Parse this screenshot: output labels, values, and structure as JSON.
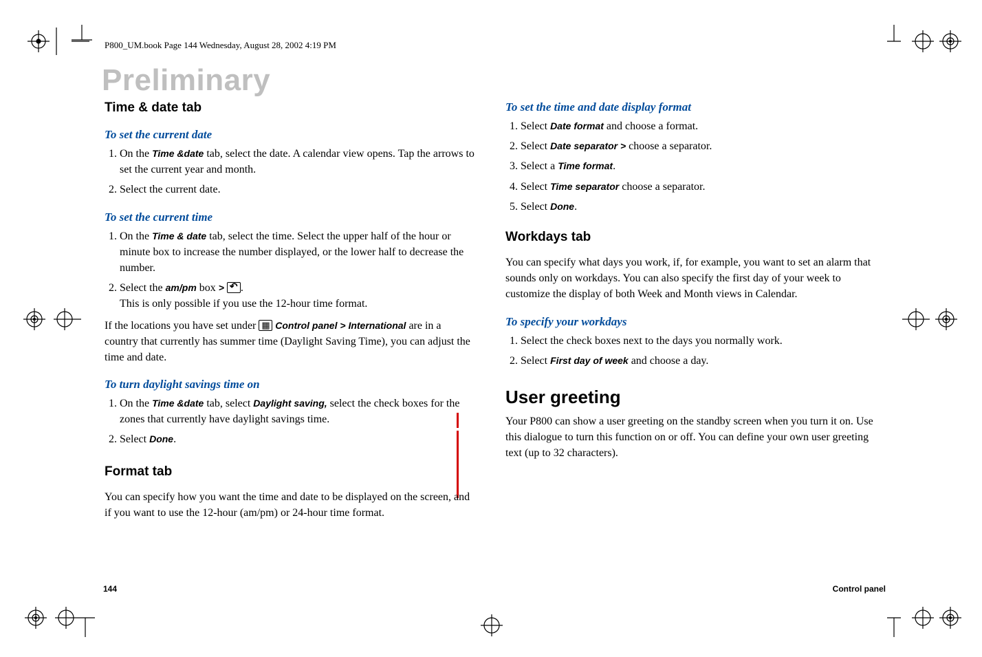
{
  "running_head": "P800_UM.book  Page 144  Wednesday, August 28, 2002  4:19 PM",
  "watermark": "Preliminary",
  "footer": {
    "page_num": "144",
    "section": "Control panel"
  },
  "left": {
    "time_date_tab": {
      "heading": "Time & date tab",
      "set_current_date": {
        "title": "To set the current date",
        "step1_a": "On the ",
        "step1_label": "Time &date",
        "step1_b": " tab, select the date. A calendar view opens. Tap the arrows to set the current year and month.",
        "step2": "Select the current date."
      },
      "set_current_time": {
        "title": "To set the current time",
        "step1_a": "On the ",
        "step1_label": "Time & date",
        "step1_b": " tab, select the time. Select the upper half of the hour or minute box to increase the number displayed, or the lower half to decrease the number.",
        "step2_a": "Select the ",
        "step2_label": "am/pm",
        "step2_b": " box ",
        "step2_gt": "> ",
        "step2_c": ".",
        "step2_note": "This is only possible if you use the 12-hour time format.",
        "para_a": "If the locations you have set under ",
        "para_label1": " Control panel > International",
        "para_b": " are in a country that currently has summer time (Daylight Saving Time), you can adjust the time and date."
      },
      "dst": {
        "title": "To turn daylight savings time on",
        "step1_a": "On the ",
        "step1_label1": "Time &date",
        "step1_b": " tab, select ",
        "step1_label2": "Daylight saving,",
        "step1_c": " select the check boxes for the zones that currently have daylight savings time.",
        "step2_a": " Select ",
        "step2_label": "Done",
        "step2_b": "."
      }
    },
    "format_tab": {
      "heading": "Format tab",
      "para": "You can specify how you want the time and date to be displayed on the screen, and if you want to use the 12-hour (am/pm) or 24-hour time format."
    }
  },
  "right": {
    "display_format": {
      "title": "To set the time and date display format",
      "s1a": "Select ",
      "s1l": "Date format",
      "s1b": " and choose a format.",
      "s2a": "Select ",
      "s2l": "Date separator > ",
      "s2b": "choose a separator.",
      "s3a": "Select a ",
      "s3l": "Time format",
      "s3b": ".",
      "s4a": "Select ",
      "s4l": "Time separator",
      "s4b": "  choose a separator.",
      "s5a": "Select ",
      "s5l": "Done",
      "s5b": "."
    },
    "workdays_tab": {
      "heading": "Workdays tab",
      "para": "You can specify what days you work, if, for example, you want to set an alarm that sounds only on workdays. You can also specify the first day of your week to customize the display of both Week and Month views in Calendar.",
      "specify": {
        "title": "To specify your workdays",
        "s1": "Select the check boxes next to the days you normally work.",
        "s2a": "Select ",
        "s2l": "First day of week",
        "s2b": " and choose a day."
      }
    },
    "user_greeting": {
      "heading": "User greeting",
      "para": "Your P800 can show a user greeting on the standby screen when you turn it on. Use this dialogue to turn this function on or off. You can define your own user greeting text (up to 32 characters)."
    }
  }
}
